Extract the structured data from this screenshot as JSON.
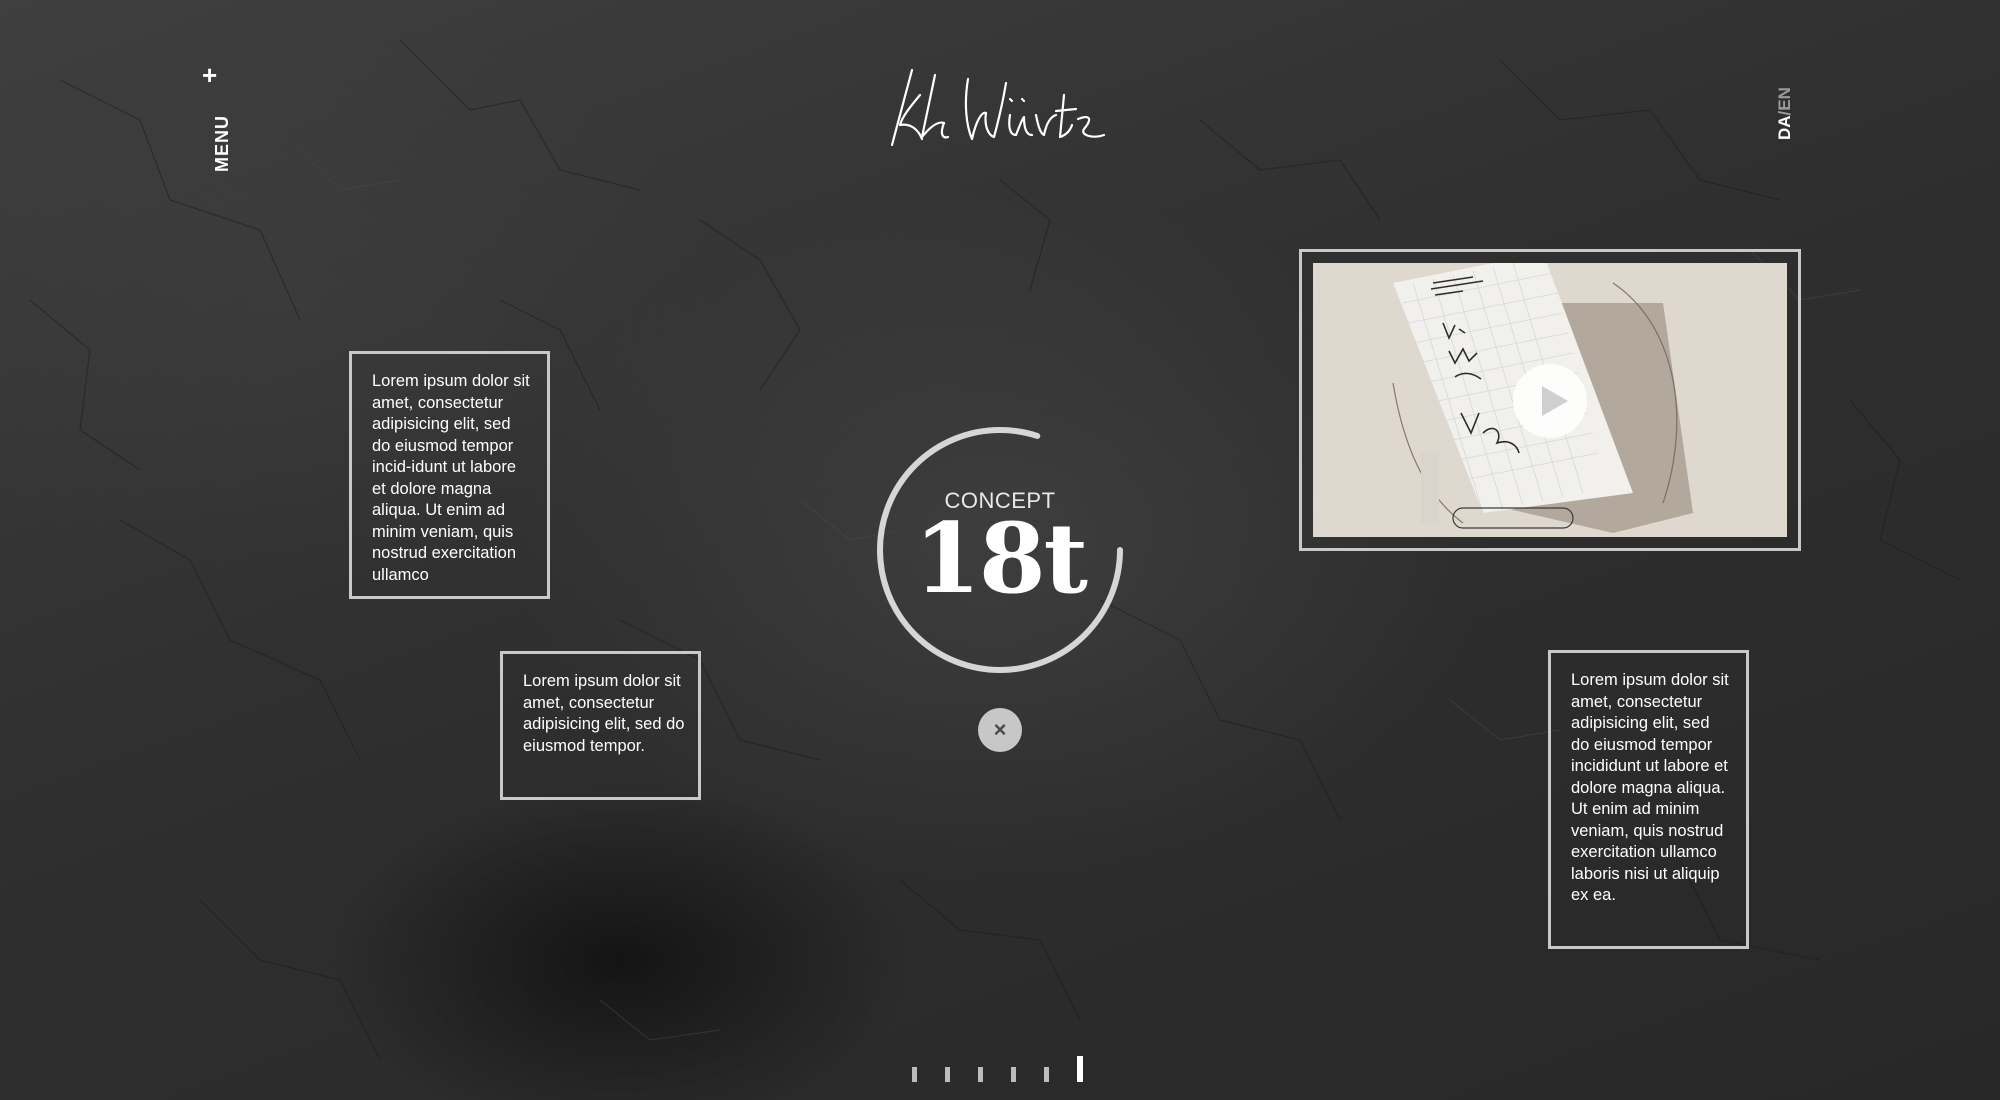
{
  "header": {
    "menu_label": "MENU",
    "menu_icon": "plus-icon",
    "logo_signature": "K.H. Würtz",
    "languages": {
      "primary": "DA",
      "separator": "/",
      "secondary": "EN",
      "active": "DA"
    }
  },
  "text_boxes": {
    "left_top": "Lorem ipsum dolor sit amet, consectetur adipisicing elit, sed do eiusmod tempor incid-idunt ut labore et dolore magna aliqua. Ut enim ad minim veniam, quis nostrud exercitation ullamco",
    "left_bottom": "Lorem ipsum dolor sit amet, consectetur adipisicing elit, sed do eiusmod tempor.",
    "right_bottom": "Lorem ipsum dolor sit amet, consectetur adipisicing elit, sed do eiusmod tempor incididunt ut labore et dolore magna aliqua. Ut enim ad minim veniam, quis nostrud exercitation ullamco laboris nisi ut aliquip ex ea."
  },
  "video": {
    "play_icon": "play-icon",
    "sketch_lines": [
      "Ny",
      "Würtz",
      "Norma"
    ]
  },
  "concept": {
    "label": "CONCEPT",
    "value": "18t",
    "ring_progress": 0.8
  },
  "close_button": {
    "icon": "close-icon",
    "glyph": "×"
  },
  "pager": {
    "count": 6,
    "active_index": 5
  },
  "colors": {
    "background": "#2f2f2f",
    "frame_border": "#c9c9c9",
    "text": "#ffffff",
    "muted": "#9a9a9a",
    "ring": "#d6d6d6"
  }
}
